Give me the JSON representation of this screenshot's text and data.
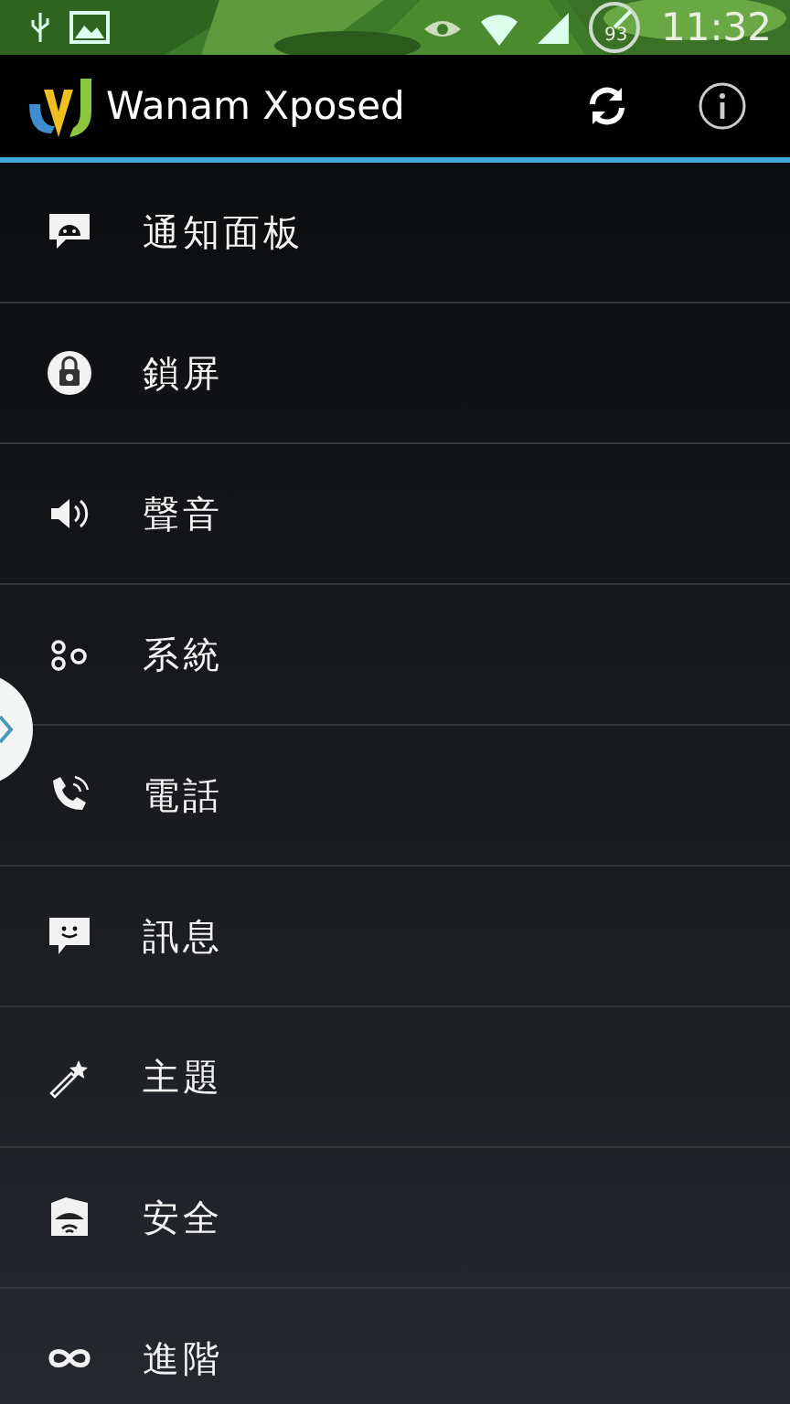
{
  "status_bar": {
    "battery": "93",
    "time": "11:32"
  },
  "action_bar": {
    "title": "Wanam Xposed"
  },
  "menu": [
    {
      "label": "通知面板"
    },
    {
      "label": "鎖屏"
    },
    {
      "label": "聲音"
    },
    {
      "label": "系統"
    },
    {
      "label": "電話"
    },
    {
      "label": "訊息"
    },
    {
      "label": "主題"
    },
    {
      "label": "安全"
    },
    {
      "label": "進階"
    }
  ]
}
